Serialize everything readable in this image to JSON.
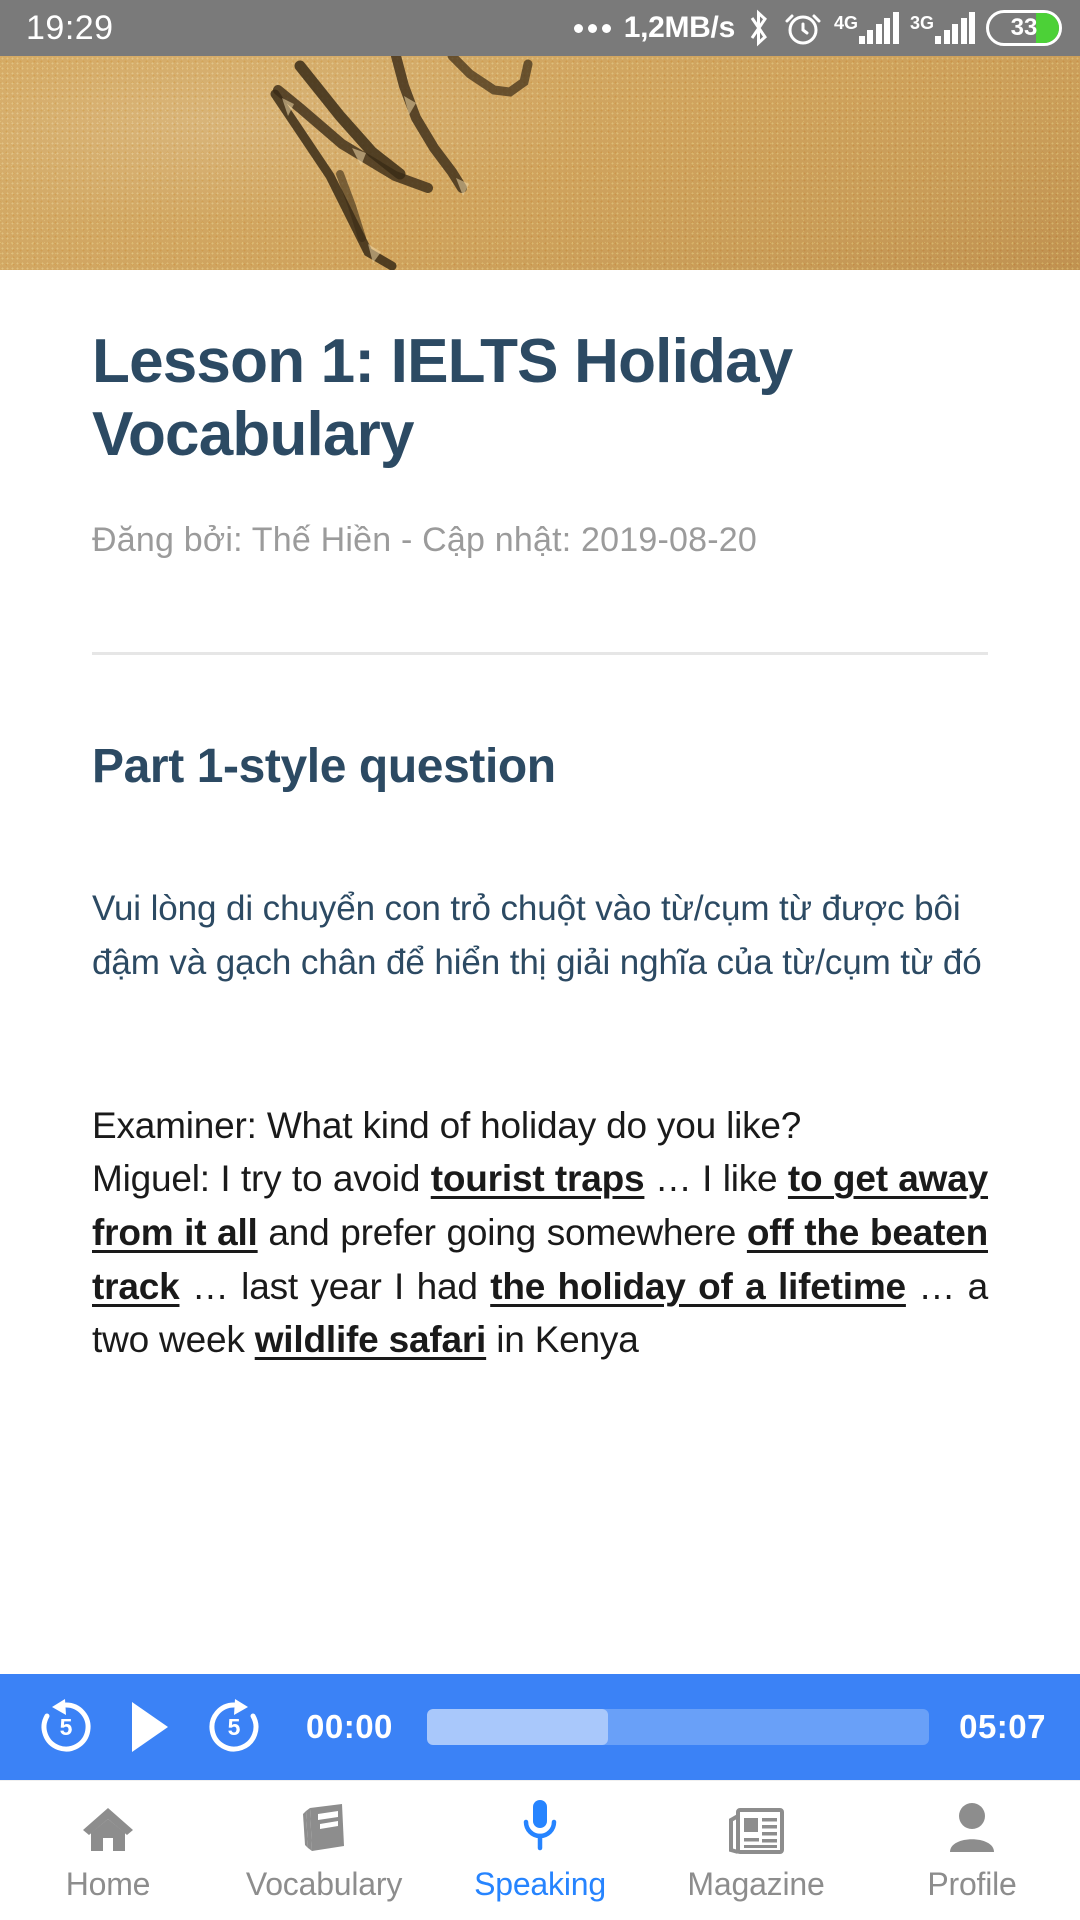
{
  "statusbar": {
    "time": "19:29",
    "network_speed": "1,2MB/s",
    "bluetooth_icon": "bluetooth-icon",
    "alarm_icon": "alarm-clock-icon",
    "signal_1_label": "4G",
    "signal_2_label": "3G",
    "battery_percent": "33"
  },
  "hero": {
    "alt": "sand-beach-photo"
  },
  "article": {
    "title": "Lesson 1: IELTS Holiday Vocabulary",
    "byline": "Đăng bởi: Thế Hiền - Cập nhật: 2019-08-20",
    "section_heading": "Part 1-style question",
    "instruction": "Vui lòng di chuyển con trỏ chuột vào từ/cụm từ được bôi đậm và gạch chân để hiển thị giải nghĩa của từ/cụm từ đó",
    "dialogue": {
      "examiner_line": "Examiner: What kind of holiday do you like?",
      "speaker": "Miguel: I try to avoid ",
      "hl1": "tourist traps",
      "seg1": " … I like ",
      "hl2": "to get away from it all",
      "seg2": " and prefer going somewhere ",
      "hl3": "off the beaten track",
      "seg3": " … last year I had ",
      "hl4": "the holiday of a lifetime",
      "seg4": " … a two week ",
      "hl5": "wildlife safari",
      "seg5": " in Kenya"
    }
  },
  "player": {
    "rewind_label": "5",
    "forward_label": "5",
    "play_icon": "play-icon",
    "current_time": "00:00",
    "total_time": "05:07",
    "progress_percent": 0,
    "buffered_percent": 36,
    "accent_color": "#3b82f6"
  },
  "nav": {
    "items": [
      {
        "label": "Home",
        "icon": "home-icon",
        "active": false
      },
      {
        "label": "Vocabulary",
        "icon": "book-icon",
        "active": false
      },
      {
        "label": "Speaking",
        "icon": "microphone-icon",
        "active": true
      },
      {
        "label": "Magazine",
        "icon": "newspaper-icon",
        "active": false
      },
      {
        "label": "Profile",
        "icon": "person-icon",
        "active": false
      }
    ],
    "active_color": "#2684ff",
    "inactive_color": "#8d8d8d"
  }
}
